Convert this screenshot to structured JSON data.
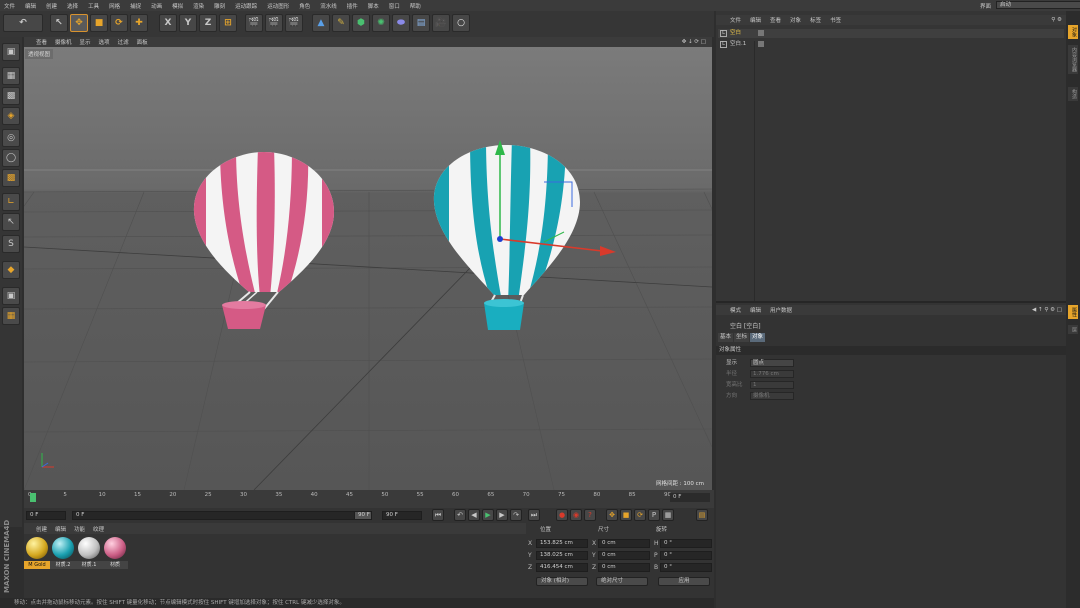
{
  "menu": [
    "文件",
    "编辑",
    "创建",
    "选择",
    "工具",
    "网格",
    "捕捉",
    "动画",
    "模拟",
    "渲染",
    "雕刻",
    "运动跟踪",
    "运动图形",
    "角色",
    "流水线",
    "插件",
    "脚本",
    "窗口",
    "帮助"
  ],
  "interface": {
    "label": "界面",
    "value": "启动"
  },
  "viewport": {
    "menu": [
      "查看",
      "摄像机",
      "显示",
      "选项",
      "过滤",
      "面板"
    ],
    "label": "透视视图",
    "grid_info": "网格间距 : 100 cm"
  },
  "timeline": {
    "ticks": [
      "0",
      "5",
      "10",
      "15",
      "20",
      "25",
      "30",
      "35",
      "40",
      "45",
      "50",
      "55",
      "60",
      "65",
      "70",
      "75",
      "80",
      "85",
      "90"
    ],
    "current_frame": "0 F"
  },
  "playback": {
    "start": "0 F",
    "range_start": "0 F",
    "range_end": "90 F",
    "end": "90 F"
  },
  "materials": {
    "menu": [
      "创建",
      "编辑",
      "功能",
      "纹理"
    ],
    "items": [
      {
        "name": "M Gold",
        "color": "#d4a820",
        "selected": true
      },
      {
        "name": "材质.2",
        "color": "#1aa0b0",
        "selected": false
      },
      {
        "name": "材质.1",
        "color": "#c0c0c0",
        "selected": false
      },
      {
        "name": "材质",
        "color": "#cc5f86",
        "selected": false
      }
    ]
  },
  "brand": "MAXON CINEMA4D",
  "coordinates": {
    "headers": {
      "position": "位置",
      "size": "尺寸",
      "rotation": "旋转"
    },
    "rows": [
      {
        "axis": "X",
        "pos": "153.825 cm",
        "size_axis": "X",
        "size": "0 cm",
        "rot_axis": "H",
        "rot": "0 °"
      },
      {
        "axis": "Y",
        "pos": "138.025 cm",
        "size_axis": "Y",
        "size": "0 cm",
        "rot_axis": "P",
        "rot": "0 °"
      },
      {
        "axis": "Z",
        "pos": "416.454 cm",
        "size_axis": "Z",
        "size": "0 cm",
        "rot_axis": "B",
        "rot": "0 °"
      }
    ],
    "mode": "对象 (相对)",
    "size_mode": "绝对尺寸",
    "apply": "应用"
  },
  "status": "移动：点击并拖动鼠标移动元素。按住 SHIFT 键量化移动；节点编辑模式时按住 SHIFT 键增加选择对象；按住 CTRL 键减少选择对象。",
  "object_manager": {
    "menu": [
      "文件",
      "编辑",
      "查看",
      "对象",
      "标签",
      "书签"
    ],
    "objects": [
      {
        "name": "空白",
        "color": "#e7c24a"
      },
      {
        "name": "空白.1",
        "color": "#c8c8c8"
      }
    ]
  },
  "attributes": {
    "menu": [
      "模式",
      "编辑",
      "用户数据"
    ],
    "title": "空白 [空白]",
    "tabs": [
      "基本",
      "坐标",
      "对象"
    ],
    "section": "对象属性",
    "rows": [
      {
        "key": "显示",
        "value": "圆点",
        "enabled": true
      },
      {
        "key": "半径",
        "value": "1.776 cm",
        "enabled": false
      },
      {
        "key": "宽高比",
        "value": "1",
        "enabled": false
      },
      {
        "key": "方向",
        "value": "摄像机",
        "enabled": false
      }
    ]
  },
  "right_tabs": [
    "对象",
    "内容浏览器",
    "构造",
    "属性",
    "层"
  ]
}
